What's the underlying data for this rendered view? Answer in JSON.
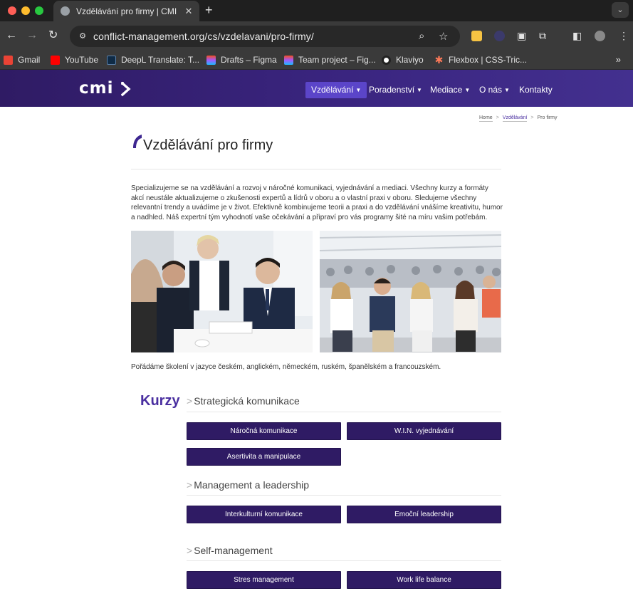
{
  "browser": {
    "tab_title": "Vzdělávání pro firmy | CMI",
    "tab_close": "✕",
    "new_tab": "+",
    "url": "conflict-management.org/cs/vzdelavani/pro-firmy/",
    "bookmarks": [
      {
        "label": "Gmail",
        "icon": "gmail-icon",
        "color": "#ea4335"
      },
      {
        "label": "YouTube",
        "icon": "youtube-icon",
        "color": "#ff0000"
      },
      {
        "label": "DeepL Translate: T...",
        "icon": "deepl-icon",
        "color": "#0f2b46"
      },
      {
        "label": "Drafts – Figma",
        "icon": "figma-icon",
        "color": "#f24e1e"
      },
      {
        "label": "Team project – Fig...",
        "icon": "figma-icon",
        "color": "#a259ff"
      },
      {
        "label": "Klaviyo",
        "icon": "klaviyo-icon",
        "color": "#ffffff"
      },
      {
        "label": "Flexbox | CSS-Tric...",
        "icon": "csstricks-icon",
        "color": "#ff7a59"
      }
    ],
    "bookmarks_more": "»"
  },
  "site": {
    "logo": "cmi",
    "nav": [
      {
        "label": "Vzdělávání",
        "dropdown": true,
        "active": true
      },
      {
        "label": "Poradenství",
        "dropdown": true,
        "active": false
      },
      {
        "label": "Mediace",
        "dropdown": true,
        "active": false
      },
      {
        "label": "O nás",
        "dropdown": true,
        "active": false
      },
      {
        "label": "Kontakty",
        "dropdown": false,
        "active": false
      }
    ],
    "accent": "#4a2fa0",
    "header_color": "#2f1b64"
  },
  "breadcrumb": {
    "home": "Home",
    "sep": ">",
    "parent": "Vzdělávání",
    "current": "Pro firmy"
  },
  "page": {
    "title": "Vzdělávání pro firmy",
    "intro": "Specializujeme se na vzdělávání a rozvoj v náročné komunikaci, vyjednávání a mediaci. Všechny kurzy a formáty akcí neustále aktualizujeme o zkušenosti expertů a lídrů v oboru a o vlastní praxi v oboru. Sledujeme všechny relevantní trendy a uvádíme je v život. Efektivně kombinujeme teorii a praxi a do vzdělávání vnášíme kreativitu, humor a nadhled. Náš expertní tým vyhodnotí vaše očekávání a připraví pro vás programy šité na míru vašim potřebám.",
    "languages": "Pořádáme školení v jazyce českém, anglickém, německém, ruském, španělském a francouzském.",
    "courses_heading": "Kurzy",
    "sections": [
      {
        "title": "Strategická komunikace",
        "courses": [
          "Náročná komunikace",
          "W.I.N. vyjednávání",
          "Asertivita a manipulace"
        ]
      },
      {
        "title": "Management a leadership",
        "courses": [
          "Interkulturní komunikace",
          "Emoční leadership"
        ]
      },
      {
        "title": "Self-management",
        "courses": [
          "Stres management",
          "Work life balance"
        ]
      }
    ]
  }
}
